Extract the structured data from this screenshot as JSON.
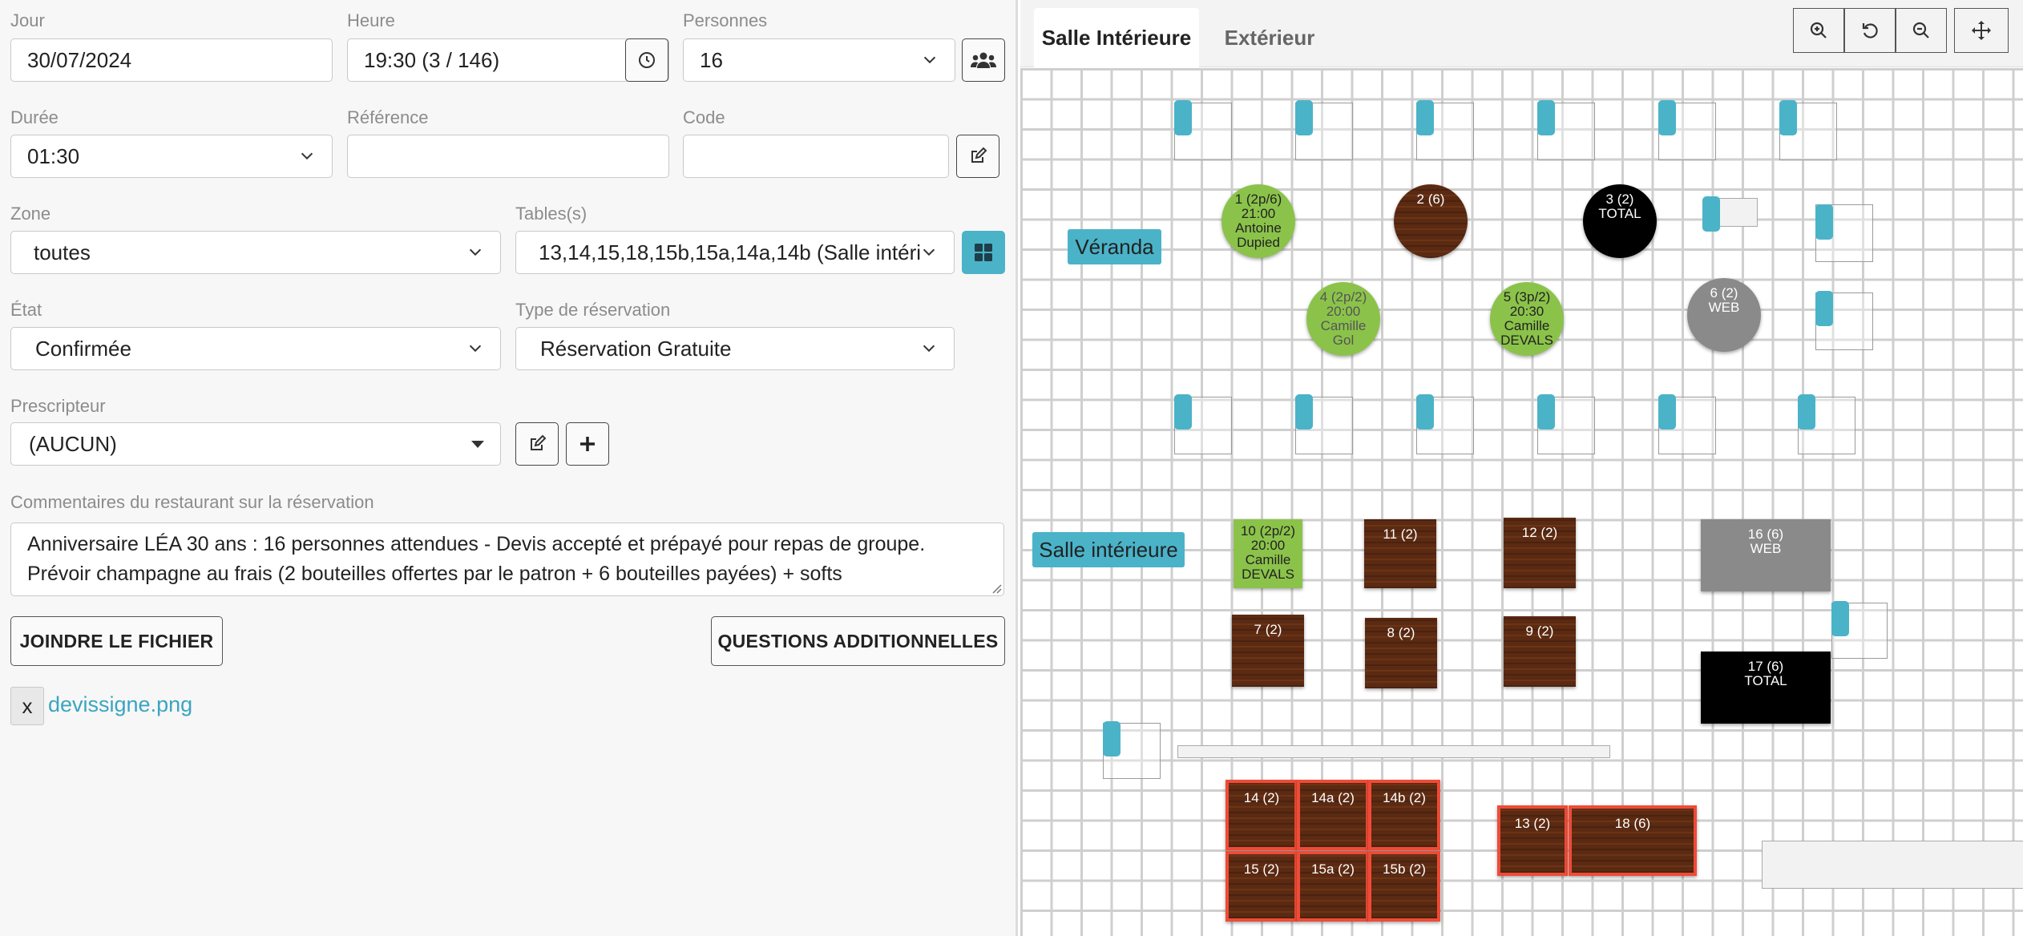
{
  "form": {
    "jour": {
      "label": "Jour",
      "value": "30/07/2024"
    },
    "heure": {
      "label": "Heure",
      "value": "19:30   (3 / 146)"
    },
    "personnes": {
      "label": "Personnes",
      "value": "16"
    },
    "duree": {
      "label": "Durée",
      "value": "01:30"
    },
    "reference": {
      "label": "Référence",
      "value": ""
    },
    "code": {
      "label": "Code",
      "value": ""
    },
    "zone": {
      "label": "Zone",
      "value": "toutes"
    },
    "tables": {
      "label": "Tables(s)",
      "value": "13,14,15,18,15b,15a,14a,14b (Salle intérie"
    },
    "etat": {
      "label": "État",
      "value": "Confirmée"
    },
    "type_reservation": {
      "label": "Type de réservation",
      "value": "Réservation Gratuite"
    },
    "prescripteur": {
      "label": "Prescripteur",
      "value": "(AUCUN)"
    },
    "commentaires": {
      "label": "Commentaires du restaurant sur la réservation",
      "line1": "Anniversaire LÉA 30 ans : 16 personnes attendues - Devis accepté et prépayé pour repas de groupe.",
      "line2": "Prévoir champagne au frais (2 bouteilles offertes par le patron + 6 bouteilles payées) + softs"
    },
    "buttons": {
      "join_file": "JOINDRE LE FICHIER",
      "questions": "QUESTIONS ADDITIONNELLES",
      "remove": "x"
    },
    "attachment": "devissigne.png"
  },
  "floor": {
    "tabs": [
      {
        "label": "Salle Intérieure",
        "active": true
      },
      {
        "label": "Extérieur",
        "active": false
      }
    ],
    "zones": {
      "veranda": "Véranda",
      "salle": "Salle intérieure"
    },
    "tables": {
      "t1": [
        "1 (2p/6)",
        "21:00",
        "Antoine",
        "Dupied"
      ],
      "t2": [
        "2 (6)"
      ],
      "t3": [
        "3 (2)",
        "TOTAL"
      ],
      "t4": [
        "4 (2p/2)",
        "20:00",
        "Camille",
        "Gol"
      ],
      "t5": [
        "5 (3p/2)",
        "20:30",
        "Camille",
        "DEVALS"
      ],
      "t6": [
        "6 (2)",
        "WEB"
      ],
      "t10": [
        "10 (2p/2)",
        "20:00",
        "Camille",
        "DEVALS"
      ],
      "t11": [
        "11 (2)"
      ],
      "t12": [
        "12 (2)"
      ],
      "t16": [
        "16 (6)",
        "WEB"
      ],
      "t7": [
        "7 (2)"
      ],
      "t8": [
        "8 (2)"
      ],
      "t9": [
        "9 (2)"
      ],
      "t17": [
        "17 (6)",
        "TOTAL"
      ],
      "t14": [
        "14 (2)"
      ],
      "t14a": [
        "14a (2)"
      ],
      "t14b": [
        "14b (2)"
      ],
      "t15": [
        "15 (2)"
      ],
      "t15a": [
        "15a (2)"
      ],
      "t15b": [
        "15b (2)"
      ],
      "t13": [
        "13 (2)"
      ],
      "t18": [
        "18 (6)"
      ]
    }
  },
  "colors": {
    "accent": "#4ab3c8",
    "reserved": "#8bc34a",
    "selected_border": "#ef4b37",
    "wood": "#5b2a12"
  }
}
